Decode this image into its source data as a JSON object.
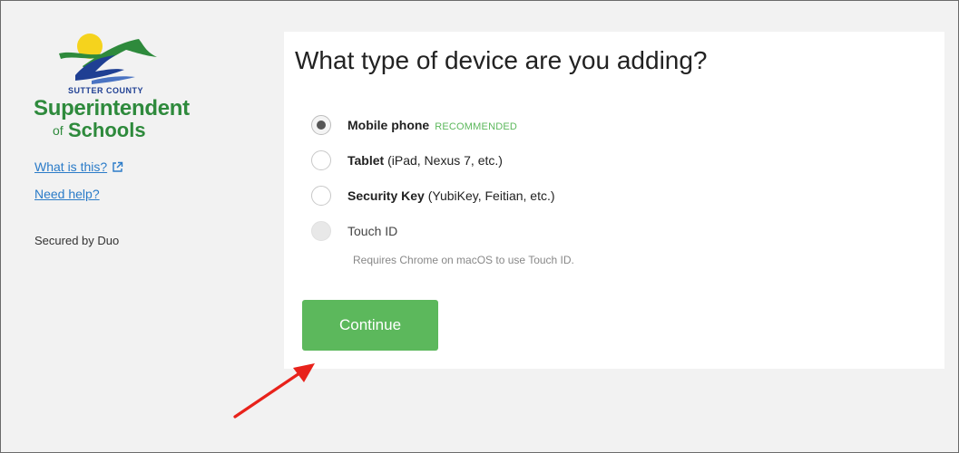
{
  "sidebar": {
    "logo": {
      "county": "SUTTER COUNTY",
      "superintendent": "Superintendent",
      "of": "of",
      "schools": "Schools"
    },
    "what_is_this": "What is this?",
    "need_help": "Need help?",
    "secured_by": "Secured by Duo"
  },
  "main": {
    "title": "What type of device are you adding?",
    "options": [
      {
        "label": "Mobile phone",
        "badge": "RECOMMENDED",
        "checked": true
      },
      {
        "label": "Tablet",
        "detail": "(iPad, Nexus 7, etc.)",
        "checked": false
      },
      {
        "label": "Security Key",
        "detail": "(YubiKey, Feitian, etc.)",
        "checked": false
      },
      {
        "label": "Touch ID",
        "disabled": true,
        "note": "Requires Chrome on macOS to use Touch ID."
      }
    ],
    "continue_label": "Continue"
  },
  "colors": {
    "accent_green": "#5cb85c",
    "link_blue": "#2a7bc8",
    "logo_green": "#2e8a3c",
    "logo_blue": "#1f3f93",
    "annotation_arrow": "#e8221b"
  },
  "icons": [
    "external-link-icon",
    "logo-sun-icon",
    "logo-wave-icon",
    "annotation-arrow"
  ]
}
